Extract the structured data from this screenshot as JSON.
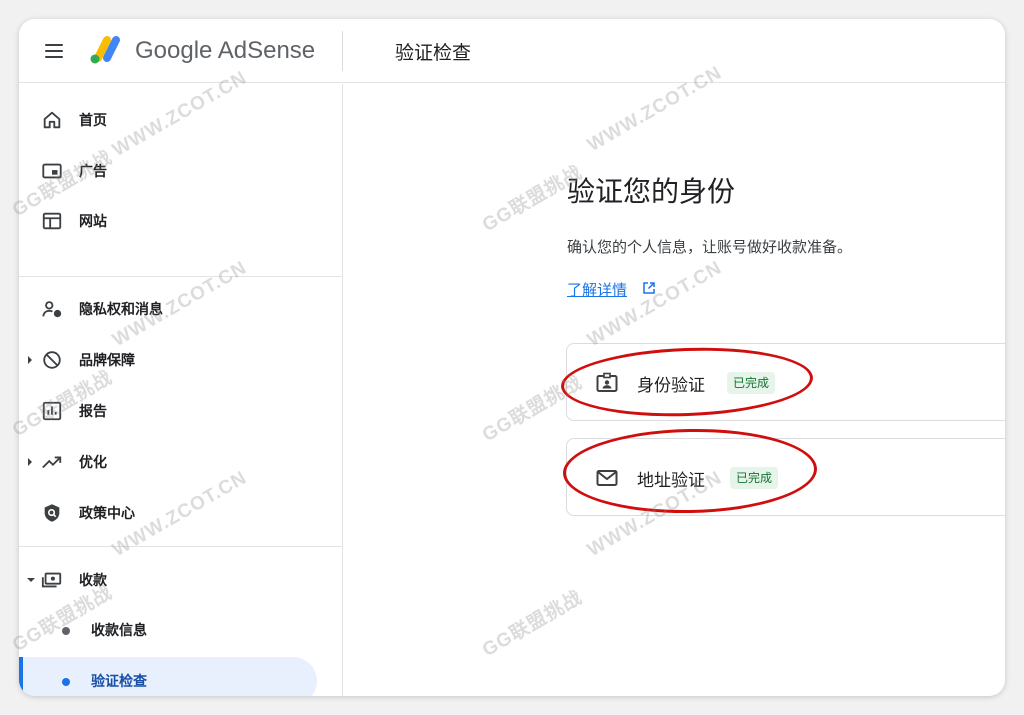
{
  "header": {
    "brand": "Google AdSense",
    "page_title": "验证检查"
  },
  "sidebar": {
    "items": [
      {
        "label": "首页",
        "icon": "home-icon"
      },
      {
        "label": "广告",
        "icon": "ads-icon"
      },
      {
        "label": "网站",
        "icon": "sites-icon"
      },
      {
        "label": "隐私权和消息",
        "icon": "privacy-icon"
      },
      {
        "label": "品牌保障",
        "icon": "block-icon"
      },
      {
        "label": "报告",
        "icon": "reports-icon"
      },
      {
        "label": "优化",
        "icon": "trending-icon"
      },
      {
        "label": "政策中心",
        "icon": "shield-icon"
      },
      {
        "label": "收款",
        "icon": "payments-icon"
      }
    ],
    "sub_items": [
      {
        "label": "收款信息"
      },
      {
        "label": "验证检查",
        "active": true
      }
    ]
  },
  "main": {
    "heading": "验证您的身份",
    "description": "确认您的个人信息，让账号做好收款准备。",
    "learn_more": "了解详情",
    "cards": [
      {
        "label": "身份验证",
        "status": "已完成",
        "icon": "id-card-icon"
      },
      {
        "label": "地址验证",
        "status": "已完成",
        "icon": "mail-icon"
      }
    ]
  },
  "watermark": {
    "brand_text": "GG联盟挑战",
    "site_text": "WWW.ZCOT.CN"
  },
  "colors": {
    "accent": "#1a73e8",
    "active_bg": "#e8f0fe",
    "badge_text": "#137333",
    "badge_bg": "#e6f4ea",
    "annotation": "#d10e0e"
  }
}
